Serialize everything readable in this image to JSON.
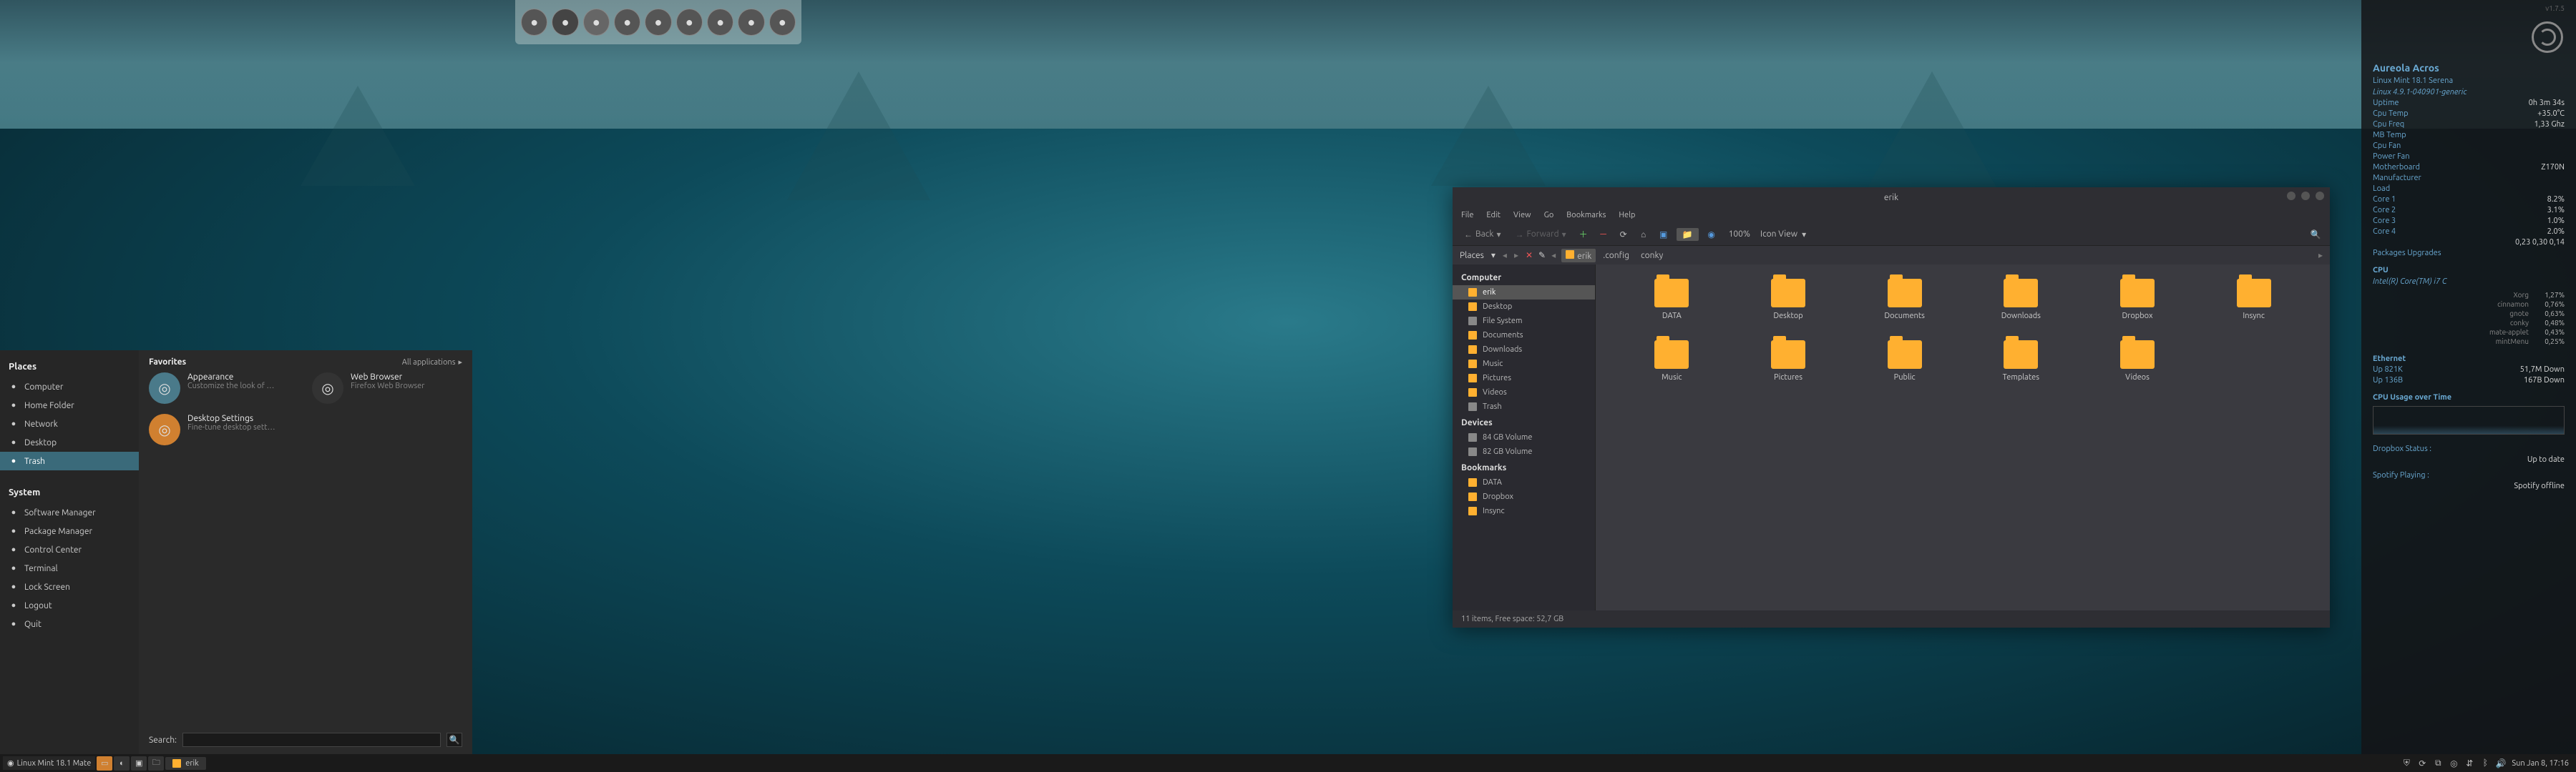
{
  "dock": {
    "items": [
      "firefox",
      "steam",
      "terminal",
      "chromium",
      "twitter",
      "files",
      "screenshot",
      "sublime",
      "skype"
    ]
  },
  "startmenu": {
    "places_h": "Places",
    "places": [
      {
        "icon": "computer",
        "label": "Computer"
      },
      {
        "icon": "folder",
        "label": "Home Folder"
      },
      {
        "icon": "network",
        "label": "Network"
      },
      {
        "icon": "desktop",
        "label": "Desktop"
      },
      {
        "icon": "trash",
        "label": "Trash",
        "sel": true
      }
    ],
    "system_h": "System",
    "system": [
      {
        "icon": "pkg",
        "label": "Software Manager"
      },
      {
        "icon": "pkg",
        "label": "Package Manager"
      },
      {
        "icon": "control",
        "label": "Control Center"
      },
      {
        "icon": "terminal",
        "label": "Terminal"
      },
      {
        "icon": "lock",
        "label": "Lock Screen"
      },
      {
        "icon": "logout",
        "label": "Logout"
      },
      {
        "icon": "quit",
        "label": "Quit"
      }
    ],
    "fav_h": "Favorites",
    "allapps": "All applications",
    "favorites": [
      {
        "title": "Appearance",
        "sub": "Customize the look of …",
        "cls": "blue"
      },
      {
        "title": "Web Browser",
        "sub": "Firefox Web Browser",
        "cls": "ff"
      },
      {
        "title": "Desktop Settings",
        "sub": "Fine-tune desktop sett…",
        "cls": "orange"
      }
    ],
    "search_label": "Search:",
    "search_value": "",
    "search_placeholder": ""
  },
  "taskbar": {
    "distro": "Linux Mint 18.1 Mate",
    "task": "erik",
    "clock": "Sun Jan  8, 17:16"
  },
  "fm": {
    "title": "erik",
    "menu": [
      "File",
      "Edit",
      "View",
      "Go",
      "Bookmarks",
      "Help"
    ],
    "back": "Back",
    "forward": "Forward",
    "zoom": "100%",
    "viewmode": "Icon View",
    "path_label": "Places",
    "crumbs": [
      {
        "t": "erik",
        "cur": true
      },
      {
        "t": ".config"
      },
      {
        "t": "conky"
      }
    ],
    "side": {
      "computer_h": "Computer",
      "computer": [
        {
          "t": "erik",
          "sel": true,
          "c": "f"
        },
        {
          "t": "Desktop",
          "c": "f"
        },
        {
          "t": "File System",
          "c": "d"
        },
        {
          "t": "Documents",
          "c": "f"
        },
        {
          "t": "Downloads",
          "c": "f"
        },
        {
          "t": "Music",
          "c": "f"
        },
        {
          "t": "Pictures",
          "c": "f"
        },
        {
          "t": "Videos",
          "c": "f"
        },
        {
          "t": "Trash",
          "c": "t"
        }
      ],
      "devices_h": "Devices",
      "devices": [
        {
          "t": "84 GB Volume",
          "c": "d"
        },
        {
          "t": "82 GB Volume",
          "c": "d"
        }
      ],
      "bookmarks_h": "Bookmarks",
      "bookmarks": [
        {
          "t": "DATA",
          "c": "f"
        },
        {
          "t": "Dropbox",
          "c": "f"
        },
        {
          "t": "Insync",
          "c": "f"
        }
      ]
    },
    "items": [
      "DATA",
      "Desktop",
      "Documents",
      "Downloads",
      "Dropbox",
      "Insync",
      "Music",
      "Pictures",
      "Public",
      "Templates",
      "Videos"
    ],
    "status": "11 items, Free space: 52,7 GB"
  },
  "conky": {
    "title": "Aureola Acros",
    "ver": "v1.7.5",
    "os": "Linux Mint 18.1 Serena",
    "kernel": "Linux 4.9.1-040901-generic",
    "rows1": [
      {
        "l": "Uptime",
        "v": "0h 3m 34s"
      },
      {
        "l": "Cpu Temp",
        "v": "+35.0°C"
      },
      {
        "l": "Cpu Freq",
        "v": "1,33 Ghz"
      },
      {
        "l": "MB Temp",
        "v": ""
      },
      {
        "l": "Cpu Fan",
        "v": ""
      },
      {
        "l": "Power Fan",
        "v": ""
      },
      {
        "l": "Motherboard",
        "v": "Z170N"
      },
      {
        "l": "Manufacturer",
        "v": ""
      }
    ],
    "load_h": "Load",
    "load_v": "0,23 0,30 0,14",
    "core_rows": [
      {
        "l": "Core 1",
        "v": "8.2%"
      },
      {
        "l": "Core 2",
        "v": "3.1%"
      },
      {
        "l": "Core 3",
        "v": "1.0%"
      },
      {
        "l": "Core 4",
        "v": "2.0%"
      }
    ],
    "pkg_l": "Packages Upgrades",
    "pkg_v": "",
    "cpu_h": "CPU",
    "cpu_m": "Intel(R) Core(TM) i7 C",
    "procs": [
      {
        "n": "Xorg",
        "p": "1,27%"
      },
      {
        "n": "cinnamon",
        "p": "0,76%"
      },
      {
        "n": "gnote",
        "p": "0,63%"
      },
      {
        "n": "conky",
        "p": "0,48%"
      },
      {
        "n": "mate-applet",
        "p": "0,43%"
      },
      {
        "n": "mintMenu",
        "p": "0,25%"
      }
    ],
    "eth_h": "Ethernet",
    "eth": [
      {
        "l": "Up 821K",
        "v": "51,7M Down"
      },
      {
        "l": "Up 136B",
        "v": "167B Down"
      }
    ],
    "cpu_time": "CPU Usage over Time",
    "dropbox_l": "Dropbox Status :",
    "dropbox_v": "Up to date",
    "spotify_l": "Spotify Playing :",
    "spotify_v": "Spotify offline"
  }
}
